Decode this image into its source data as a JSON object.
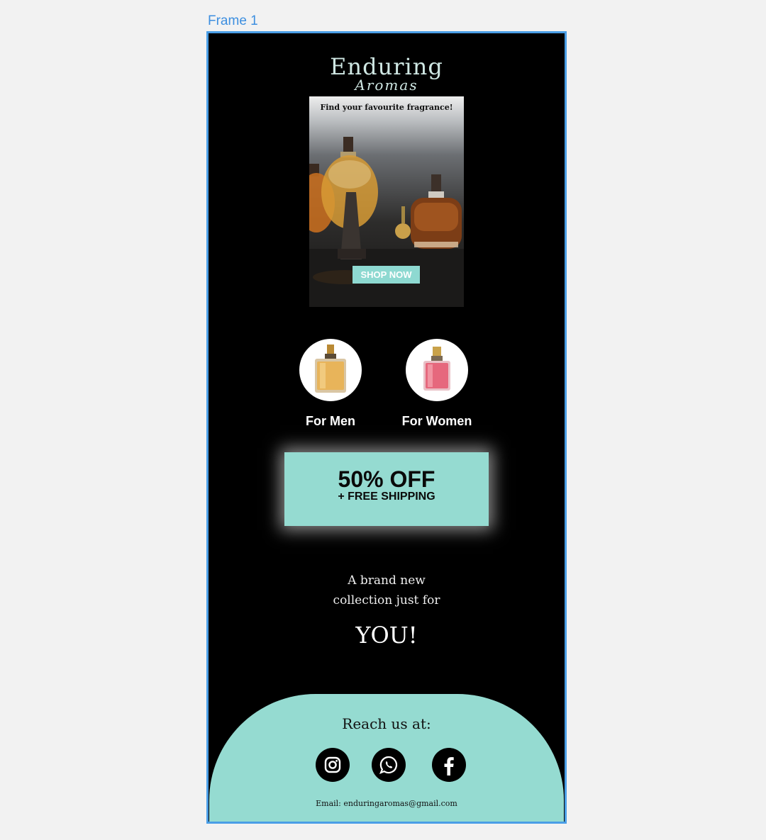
{
  "canvas": {
    "frame_label": "Frame 1"
  },
  "email": {
    "logo": {
      "line1": "Enduring",
      "line2": "Aromas"
    },
    "hero": {
      "caption": "Find your favourite fragrance!",
      "button": "SHOP NOW"
    },
    "categories": [
      {
        "label": "For Men",
        "bottle_color": "#e8b45a"
      },
      {
        "label": "For Women",
        "bottle_color": "#e6687d"
      }
    ],
    "promo": {
      "headline": "50% OFF",
      "subline": "+ FREE SHIPPING"
    },
    "tagline": {
      "line1": "A brand new",
      "line2": "collection just for",
      "line3": "YOU!"
    },
    "footer": {
      "heading": "Reach us at:",
      "socials": [
        "instagram-icon",
        "whatsapp-icon",
        "facebook-icon"
      ],
      "email_text": "Email: enduringaromas@gmail.com"
    }
  },
  "colors": {
    "accent": "#95dbd1",
    "frame_border": "#4a9ee6",
    "background": "#000000"
  }
}
